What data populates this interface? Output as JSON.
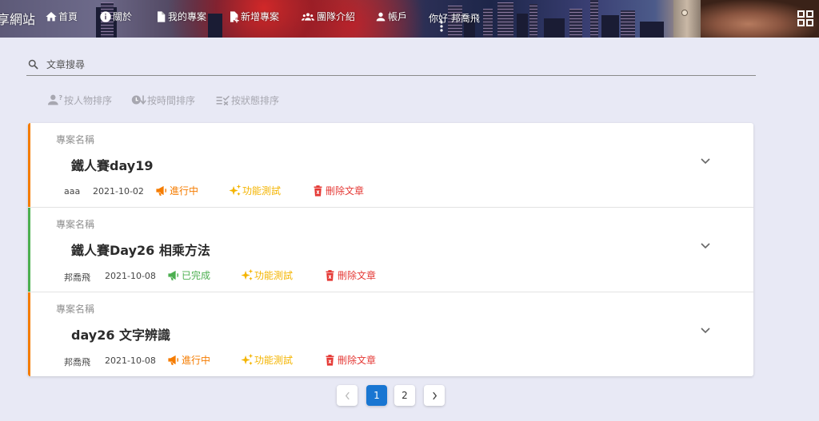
{
  "header": {
    "brand": "享網站",
    "nav": [
      {
        "label": "首頁",
        "icon": "home-icon"
      },
      {
        "label": "關於",
        "icon": "info-icon"
      },
      {
        "label": "我的專案",
        "icon": "file-icon"
      },
      {
        "label": "新增專案",
        "icon": "file-add-icon"
      },
      {
        "label": "團隊介紹",
        "icon": "group-icon"
      },
      {
        "label": "帳戶",
        "icon": "account-icon"
      }
    ],
    "greeting": "你好 邦喬飛"
  },
  "search": {
    "placeholder": "文章搜尋"
  },
  "sort": [
    {
      "label": "按人物排序",
      "icon": "person-help-icon"
    },
    {
      "label": "按時間排序",
      "icon": "clock-down-icon"
    },
    {
      "label": "按狀態排序",
      "icon": "checklist-icon"
    }
  ],
  "cards": [
    {
      "label": "專案名稱",
      "title": "鐵人賽day19",
      "author": "aaa",
      "date": "2021-10-02",
      "status": "進行中",
      "tag": "功能測試",
      "delete": "刪除文章",
      "accent": "#f57c00",
      "status_color": "#f57c00"
    },
    {
      "label": "專案名稱",
      "title": "鐵人賽Day26 相乘方法",
      "author": "邦喬飛",
      "date": "2021-10-08",
      "status": "已完成",
      "tag": "功能測試",
      "delete": "刪除文章",
      "accent": "#4caf50",
      "status_color": "#4caf50"
    },
    {
      "label": "專案名稱",
      "title": "day26 文字辨識",
      "author": "邦喬飛",
      "date": "2021-10-08",
      "status": "進行中",
      "tag": "功能測試",
      "delete": "刪除文章",
      "accent": "#f57c00",
      "status_color": "#f57c00"
    }
  ],
  "pagination": {
    "pages": [
      "1",
      "2"
    ],
    "current": "1"
  }
}
